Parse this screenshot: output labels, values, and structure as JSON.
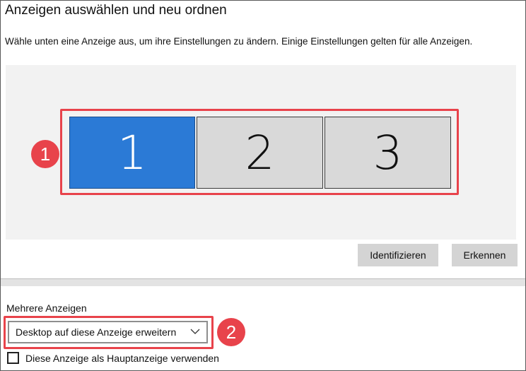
{
  "header": {
    "title": "Anzeigen auswählen und neu ordnen",
    "subtitle": "Wähle unten eine Anzeige aus, um ihre Einstellungen zu ändern. Einige Einstellungen gelten für alle Anzeigen."
  },
  "displays": [
    {
      "label": "1",
      "selected": true
    },
    {
      "label": "2",
      "selected": false
    },
    {
      "label": "3",
      "selected": false
    }
  ],
  "buttons": {
    "identify": "Identifizieren",
    "detect": "Erkennen"
  },
  "multiple_displays": {
    "label": "Mehrere Anzeigen",
    "selected_option": "Desktop auf diese Anzeige erweitern",
    "main_display_checkbox_label": "Diese Anzeige als Hauptanzeige verwenden",
    "main_display_checked": false
  },
  "annotations": [
    "1",
    "2"
  ],
  "colors": {
    "selected_display": "#2b7ad6",
    "unselected_display": "#d9d9d9",
    "highlight": "#e8434b",
    "canvas": "#f2f2f2"
  }
}
